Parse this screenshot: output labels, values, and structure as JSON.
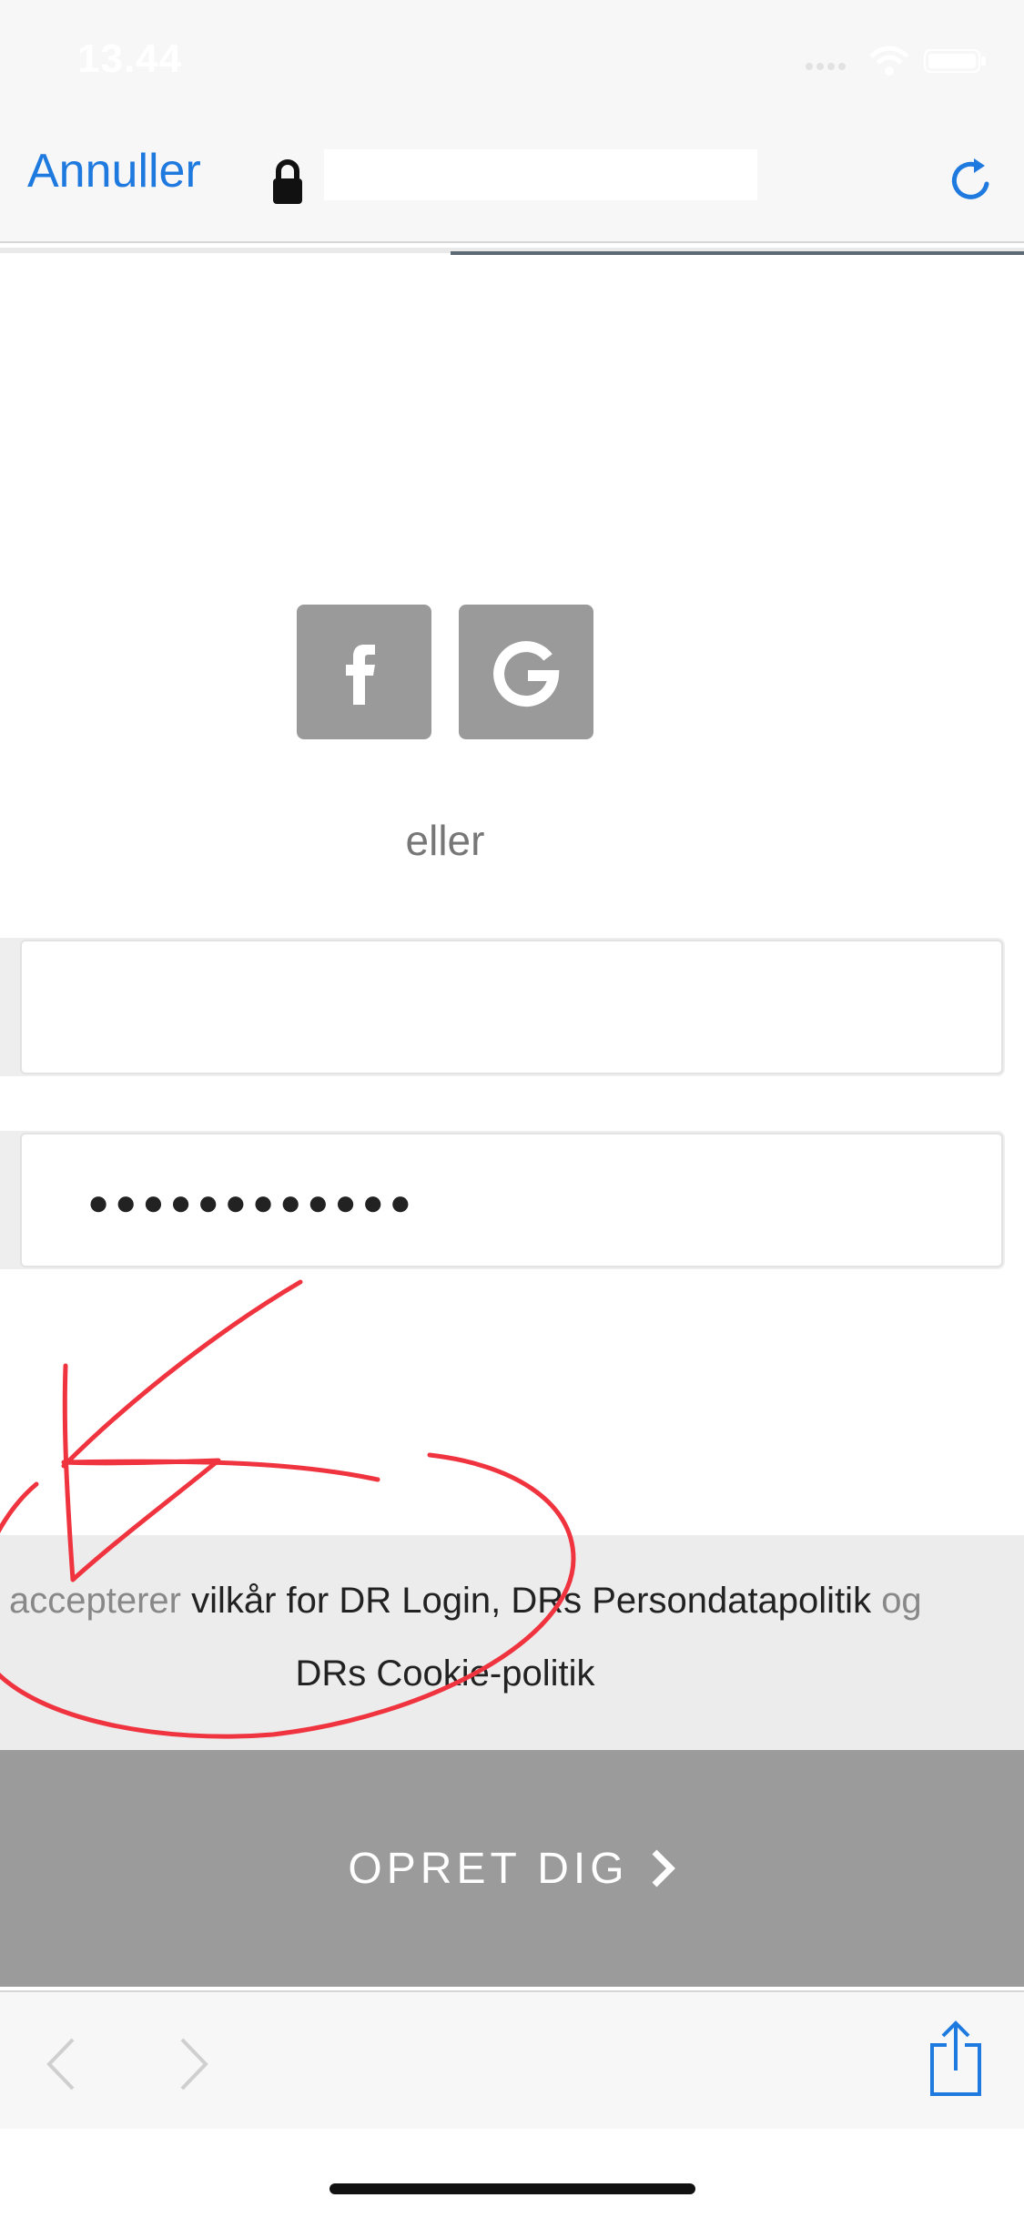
{
  "status_bar": {
    "time": "13.44"
  },
  "nav_bar": {
    "cancel_label": "Annuller",
    "url_value": "",
    "lock_icon": "lock-icon",
    "reload_icon": "reload-icon"
  },
  "page_load_progress": 0.44,
  "social": {
    "facebook_icon": "facebook-icon",
    "google_icon": "google-icon"
  },
  "divider_text": "eller",
  "form": {
    "email_value": "",
    "password_value": "●●●●●●●●●●●●"
  },
  "terms": {
    "prefix": "accepterer",
    "middle": " vilkår for DR Login, DRs Persondatapolitik ",
    "suffix": "og",
    "line2": "DRs Cookie-politik"
  },
  "cta": {
    "label": "OPRET DIG",
    "chevron_icon": "chevron-right-icon"
  },
  "toolbar": {
    "back_icon": "back-icon",
    "forward_icon": "forward-icon",
    "share_icon": "share-icon"
  },
  "colors": {
    "accent": "#1f7ae0",
    "social_bg": "#9a9a9a",
    "cta_bg": "#9b9b9b",
    "annotation": "#f0343f"
  }
}
